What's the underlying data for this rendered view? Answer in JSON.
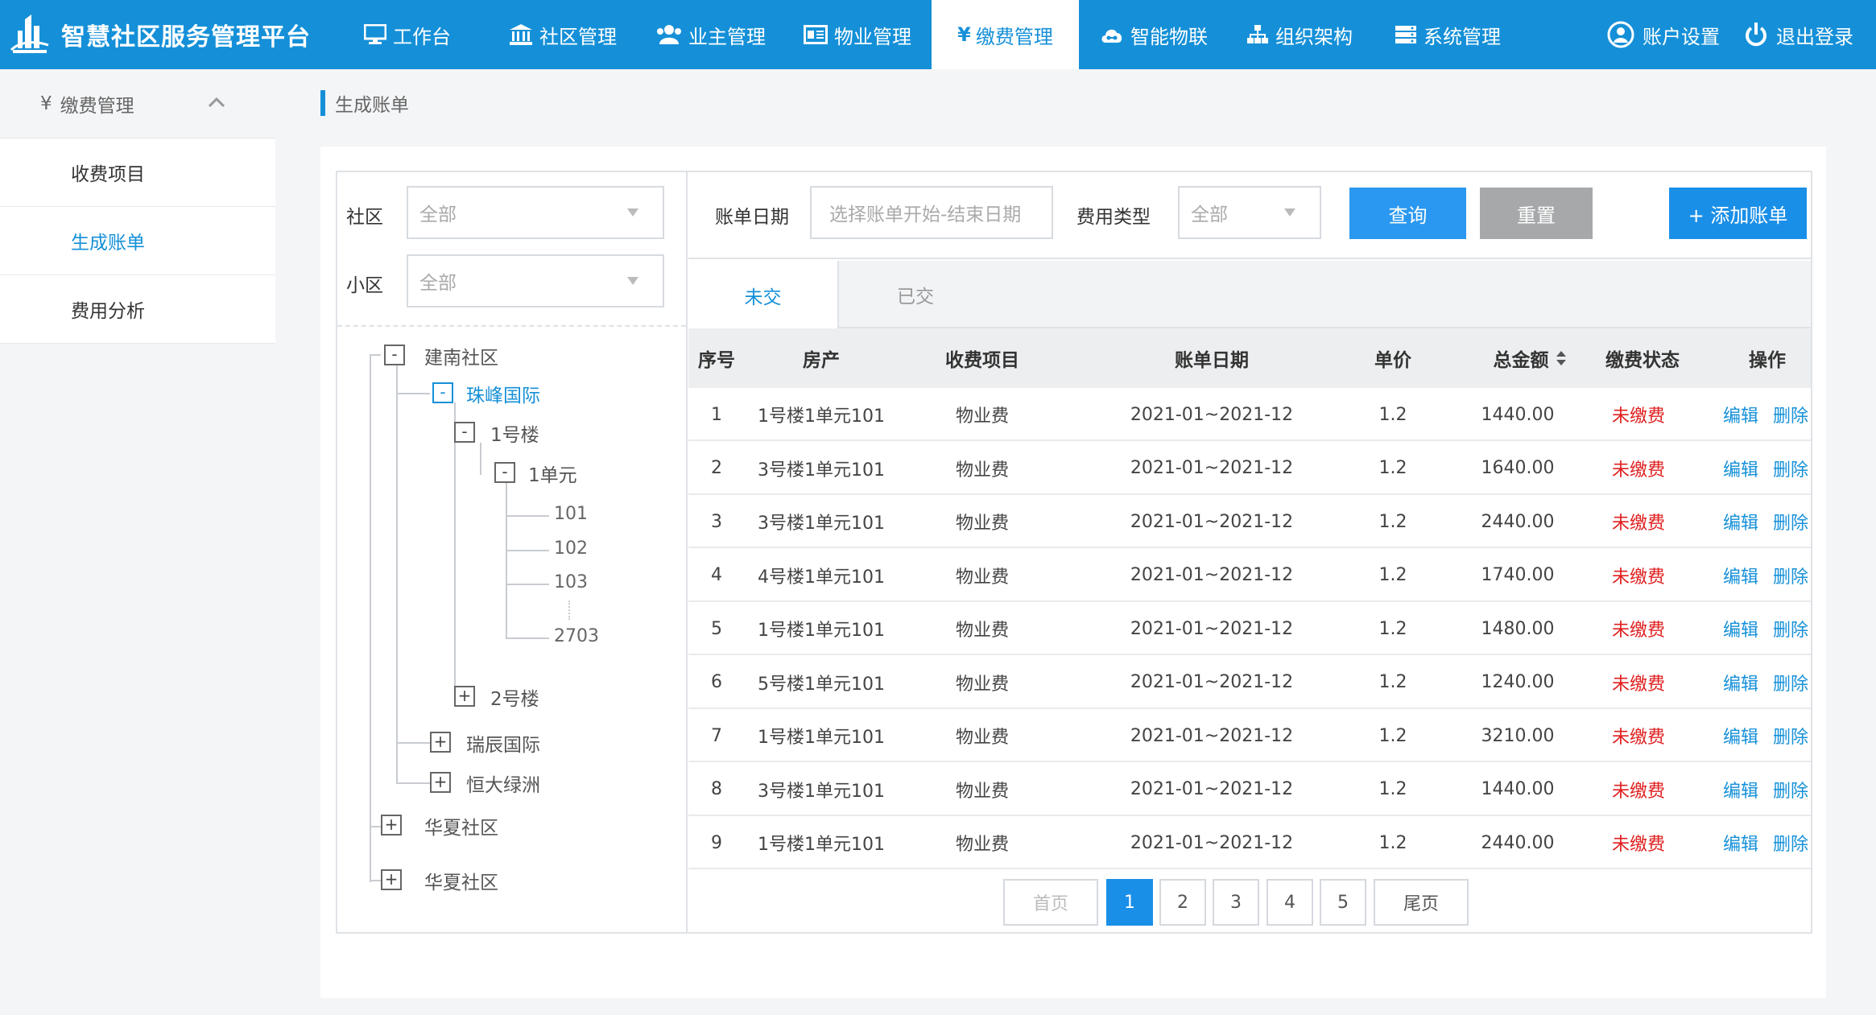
{
  "app": {
    "title": "智慧社区服务管理平台"
  },
  "nav": {
    "items": [
      {
        "label": "工作台",
        "icon": "monitor-icon"
      },
      {
        "label": "社区管理",
        "icon": "bank-icon"
      },
      {
        "label": "业主管理",
        "icon": "users-icon"
      },
      {
        "label": "物业管理",
        "icon": "id-card-icon"
      },
      {
        "label": "缴费管理",
        "icon": "yen-icon"
      },
      {
        "label": "智能物联",
        "icon": "cloud-icon"
      },
      {
        "label": "组织架构",
        "icon": "sitemap-icon"
      },
      {
        "label": "系统管理",
        "icon": "server-icon"
      }
    ],
    "active": "缴费管理",
    "account": "账户设置",
    "logout": "退出登录"
  },
  "sidebar": {
    "section_icon": "¥",
    "section": "缴费管理",
    "items": [
      {
        "label": "收费项目"
      },
      {
        "label": "生成账单"
      },
      {
        "label": "费用分析"
      }
    ]
  },
  "breadcrumb": "生成账单",
  "filters": {
    "community_label": "社区",
    "community_value": "全部",
    "estate_label": "小区",
    "estate_value": "全部",
    "date_label": "账单日期",
    "date_placeholder": "选择账单开始-结束日期",
    "fee_type_label": "费用类型",
    "fee_type_value": "全部",
    "query": "查询",
    "reset": "重置",
    "add": "+ 添加账单"
  },
  "tree": {
    "n1": "建南社区",
    "n1_1": "珠峰国际",
    "n1_1_1": "1号楼",
    "n1_1_1_1": "1单元",
    "leaves": [
      "101",
      "102",
      "103",
      "2703"
    ],
    "n1_1_2": "2号楼",
    "n1_2": "瑞辰国际",
    "n1_3": "恒大绿洲",
    "n2": "华夏社区",
    "n3": "华夏社区",
    "expanded": "-",
    "collapsed": "+"
  },
  "tabs": {
    "unpaid": "未交",
    "paid": "已交"
  },
  "table": {
    "headers": {
      "index": "序号",
      "property": "房产",
      "item": "收费项目",
      "date": "账单日期",
      "price": "单价",
      "total": "总金额",
      "status": "缴费状态",
      "ops": "操作"
    },
    "edit": "编辑",
    "delete": "删除",
    "rows": [
      {
        "index": "1",
        "property": "1号楼1单元101",
        "item": "物业费",
        "date": "2021-01~2021-12",
        "price": "1.2",
        "total": "1440.00",
        "status": "未缴费"
      },
      {
        "index": "2",
        "property": "3号楼1单元101",
        "item": "物业费",
        "date": "2021-01~2021-12",
        "price": "1.2",
        "total": "1640.00",
        "status": "未缴费"
      },
      {
        "index": "3",
        "property": "3号楼1单元101",
        "item": "物业费",
        "date": "2021-01~2021-12",
        "price": "1.2",
        "total": "2440.00",
        "status": "未缴费"
      },
      {
        "index": "4",
        "property": "4号楼1单元101",
        "item": "物业费",
        "date": "2021-01~2021-12",
        "price": "1.2",
        "total": "1740.00",
        "status": "未缴费"
      },
      {
        "index": "5",
        "property": "1号楼1单元101",
        "item": "物业费",
        "date": "2021-01~2021-12",
        "price": "1.2",
        "total": "1480.00",
        "status": "未缴费"
      },
      {
        "index": "6",
        "property": "5号楼1单元101",
        "item": "物业费",
        "date": "2021-01~2021-12",
        "price": "1.2",
        "total": "1240.00",
        "status": "未缴费"
      },
      {
        "index": "7",
        "property": "1号楼1单元101",
        "item": "物业费",
        "date": "2021-01~2021-12",
        "price": "1.2",
        "total": "3210.00",
        "status": "未缴费"
      },
      {
        "index": "8",
        "property": "3号楼1单元101",
        "item": "物业费",
        "date": "2021-01~2021-12",
        "price": "1.2",
        "total": "1440.00",
        "status": "未缴费"
      },
      {
        "index": "9",
        "property": "1号楼1单元101",
        "item": "物业费",
        "date": "2021-01~2021-12",
        "price": "1.2",
        "total": "2440.00",
        "status": "未缴费"
      }
    ]
  },
  "pagination": {
    "first": "首页",
    "pages": [
      "1",
      "2",
      "3",
      "4",
      "5"
    ],
    "current": "1",
    "last": "尾页"
  },
  "colors": {
    "primary": "#1590d8",
    "unpaid_status": "#e02020",
    "reset_button": "#a6a8aa"
  }
}
